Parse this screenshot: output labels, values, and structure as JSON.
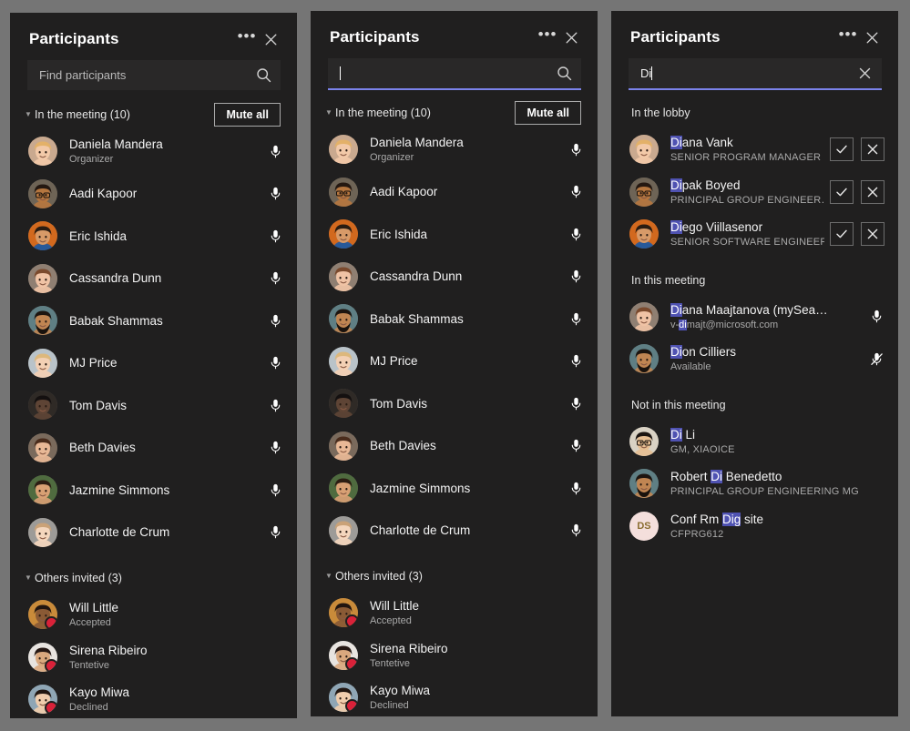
{
  "panels": [
    {
      "title": "Participants",
      "more_label": "•••",
      "close_label": "✕",
      "search": {
        "placeholder": "Find participants",
        "value": "",
        "focused": false,
        "icon": "search-icon"
      },
      "sections": [
        {
          "label": "In the meeting (10)",
          "collapsible": true,
          "action_label": "Mute all",
          "rows": [
            {
              "name": "Daniela Mandera",
              "sub": "Organizer",
              "mic": "unmuted",
              "avatar": "blonde-woman"
            },
            {
              "name": "Aadi Kapoor",
              "sub": "",
              "mic": "unmuted",
              "avatar": "man-glasses-dark"
            },
            {
              "name": "Eric Ishida",
              "sub": "",
              "mic": "unmuted",
              "avatar": "man-blue-shirt-orange"
            },
            {
              "name": "Cassandra Dunn",
              "sub": "",
              "mic": "unmuted",
              "avatar": "woman-auburn"
            },
            {
              "name": "Babak Shammas",
              "sub": "",
              "mic": "unmuted",
              "avatar": "man-beard-teal"
            },
            {
              "name": "MJ Price",
              "sub": "",
              "mic": "unmuted",
              "avatar": "woman-blonde-light"
            },
            {
              "name": "Tom Davis",
              "sub": "",
              "mic": "unmuted",
              "avatar": "man-dark-photo"
            },
            {
              "name": "Beth Davies",
              "sub": "",
              "mic": "unmuted",
              "avatar": "woman-brunette"
            },
            {
              "name": "Jazmine Simmons",
              "sub": "",
              "mic": "unmuted",
              "avatar": "woman-green-bg"
            },
            {
              "name": "Charlotte de Crum",
              "sub": "",
              "mic": "unmuted",
              "avatar": "woman-pale"
            }
          ]
        },
        {
          "label": "Others invited (3)",
          "collapsible": true,
          "action_label": "",
          "rows": [
            {
              "name": "Will Little",
              "sub": "Accepted",
              "badge": "busy",
              "avatar": "man-smiling-warm"
            },
            {
              "name": "Sirena Ribeiro",
              "sub": "Tentetive",
              "badge": "busy",
              "avatar": "woman-dark-hair"
            },
            {
              "name": "Kayo Miwa",
              "sub": "Declined",
              "badge": "busy",
              "avatar": "woman-short-hair"
            }
          ]
        }
      ]
    },
    {
      "title": "Participants",
      "more_label": "•••",
      "close_label": "✕",
      "search": {
        "placeholder": "",
        "value": "",
        "focused": true,
        "icon": "search-icon"
      },
      "sections": [
        {
          "label": "In the meeting (10)",
          "collapsible": true,
          "action_label": "Mute all",
          "rows": [
            {
              "name": "Daniela Mandera",
              "sub": "Organizer",
              "mic": "unmuted",
              "avatar": "blonde-woman"
            },
            {
              "name": "Aadi Kapoor",
              "sub": "",
              "mic": "unmuted",
              "avatar": "man-glasses-dark"
            },
            {
              "name": "Eric Ishida",
              "sub": "",
              "mic": "unmuted",
              "avatar": "man-blue-shirt-orange"
            },
            {
              "name": "Cassandra Dunn",
              "sub": "",
              "mic": "unmuted",
              "avatar": "woman-auburn"
            },
            {
              "name": "Babak Shammas",
              "sub": "",
              "mic": "unmuted",
              "avatar": "man-beard-teal"
            },
            {
              "name": "MJ Price",
              "sub": "",
              "mic": "unmuted",
              "avatar": "woman-blonde-light"
            },
            {
              "name": "Tom Davis",
              "sub": "",
              "mic": "unmuted",
              "avatar": "man-dark-photo"
            },
            {
              "name": "Beth Davies",
              "sub": "",
              "mic": "unmuted",
              "avatar": "woman-brunette"
            },
            {
              "name": "Jazmine Simmons",
              "sub": "",
              "mic": "unmuted",
              "avatar": "woman-green-bg"
            },
            {
              "name": "Charlotte de Crum",
              "sub": "",
              "mic": "unmuted",
              "avatar": "woman-pale"
            }
          ]
        },
        {
          "label": "Others invited (3)",
          "collapsible": true,
          "action_label": "",
          "rows": [
            {
              "name": "Will Little",
              "sub": "Accepted",
              "badge": "busy",
              "avatar": "man-smiling-warm"
            },
            {
              "name": "Sirena Ribeiro",
              "sub": "Tentetive",
              "badge": "busy",
              "avatar": "woman-dark-hair"
            },
            {
              "name": "Kayo Miwa",
              "sub": "Declined",
              "badge": "busy",
              "avatar": "woman-short-hair"
            }
          ]
        }
      ]
    },
    {
      "title": "Participants",
      "more_label": "•••",
      "close_label": "✕",
      "search": {
        "placeholder": "",
        "value": "Di",
        "focused": true,
        "icon": "clear-icon"
      },
      "sections": [
        {
          "label": "In the lobby",
          "collapsible": false,
          "action_label": "",
          "rows": [
            {
              "name": "Diana Vank",
              "hl": "Di",
              "sub": "SENIOR PROGRAM MANAGER",
              "caps": true,
              "lobby": true,
              "avatar": "blonde-woman"
            },
            {
              "name": "Dipak Boyed",
              "hl": "Di",
              "sub": "PRINCIPAL GROUP ENGINEER…",
              "caps": true,
              "lobby": true,
              "avatar": "man-glasses-dark"
            },
            {
              "name": "Diego Viillasenor",
              "hl": "Di",
              "sub": "SENIOR SOFTWARE ENGINEER",
              "caps": true,
              "lobby": true,
              "avatar": "man-blue-shirt-orange"
            }
          ]
        },
        {
          "label": "In this meeting",
          "collapsible": false,
          "action_label": "",
          "rows": [
            {
              "name": "Diana Maajtanova (mySea…",
              "hl": "Di",
              "sub": "v-dimajt@microsoft.com",
              "sub_hl": "di",
              "mic": "unmuted",
              "avatar": "woman-auburn"
            },
            {
              "name": "Dion Cilliers",
              "hl": "Di",
              "sub": "Available",
              "mic": "muted",
              "avatar": "man-beard-teal"
            }
          ]
        },
        {
          "label": "Not in this meeting",
          "collapsible": false,
          "action_label": "",
          "rows": [
            {
              "name": "Di Li",
              "hl": "Di",
              "sub": "GM, XIAOICE",
              "caps": true,
              "avatar": "man-asian-glasses"
            },
            {
              "name": "Robert Di Benedetto",
              "hl": "Di",
              "sub": "PRINCIPAL GROUP ENGINEERING MG",
              "caps": true,
              "avatar": "man-beard-teal"
            },
            {
              "name": "Conf Rm Dig site",
              "hl": "Dig",
              "sub": "CFPRG612",
              "caps": true,
              "avatar": "initials",
              "initials": "DS"
            }
          ]
        }
      ]
    }
  ],
  "colors": {
    "page_background": "#757575",
    "panel_background": "#201f1f",
    "search_background": "#292828",
    "focus_underline": "#7b83eb",
    "highlight": "#4f52b2",
    "presence_busy": "#d92139",
    "text_primary": "#f3f3f3",
    "text_secondary": "#a9a9a9",
    "initials_avatar_background": "#f4dfdc",
    "initials_avatar_text": "#8a6d2f"
  },
  "icons": {
    "search": "search-icon",
    "clear": "clear-icon",
    "more": "more-options-icon",
    "close": "close-icon",
    "mic_unmuted": "microphone-icon",
    "mic_muted": "microphone-muted-icon",
    "admit": "checkmark-icon",
    "deny": "cross-icon",
    "chevron": "chevron-down-icon"
  }
}
